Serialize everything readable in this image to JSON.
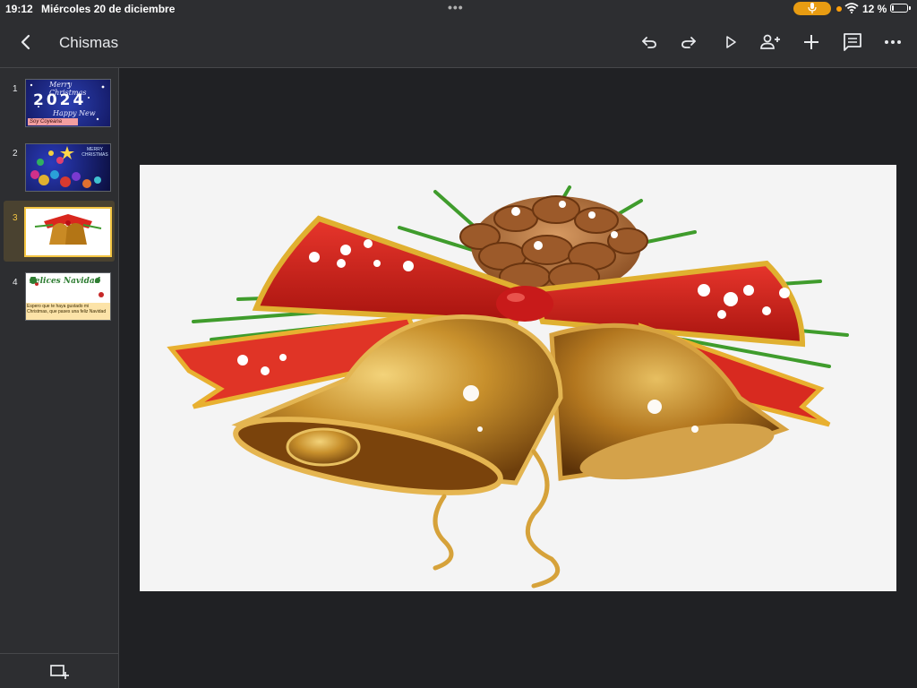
{
  "status_bar": {
    "time": "19:12",
    "date": "Miércoles 20 de diciembre",
    "dots": "•••",
    "battery_text": "12 %",
    "battery_level": 0.12,
    "mic_pill_color": "#e89c12"
  },
  "toolbar": {
    "title": "Chismas",
    "buttons": [
      "undo-icon",
      "redo-icon",
      "play-icon",
      "add-person-icon",
      "add-icon",
      "comment-icon",
      "more-icon"
    ]
  },
  "slides": [
    {
      "number": "1",
      "year": "2024",
      "script_top": "Merry Christmas",
      "script_bottom": "Happy New Year",
      "caption": "Soy Coyeana"
    },
    {
      "number": "2",
      "label": "MERRY CHRISTMAS"
    },
    {
      "number": "3"
    },
    {
      "number": "4",
      "banner": "Felices Navidad",
      "message": "Espero que te haya gustado mi Christmas, que pases una feliz Navidad"
    }
  ],
  "selected_slide": "3",
  "colors": {
    "background": "#202124",
    "panel": "#2d2e31",
    "selection_accent": "#f4c542",
    "canvas": "#f4f4f4"
  }
}
